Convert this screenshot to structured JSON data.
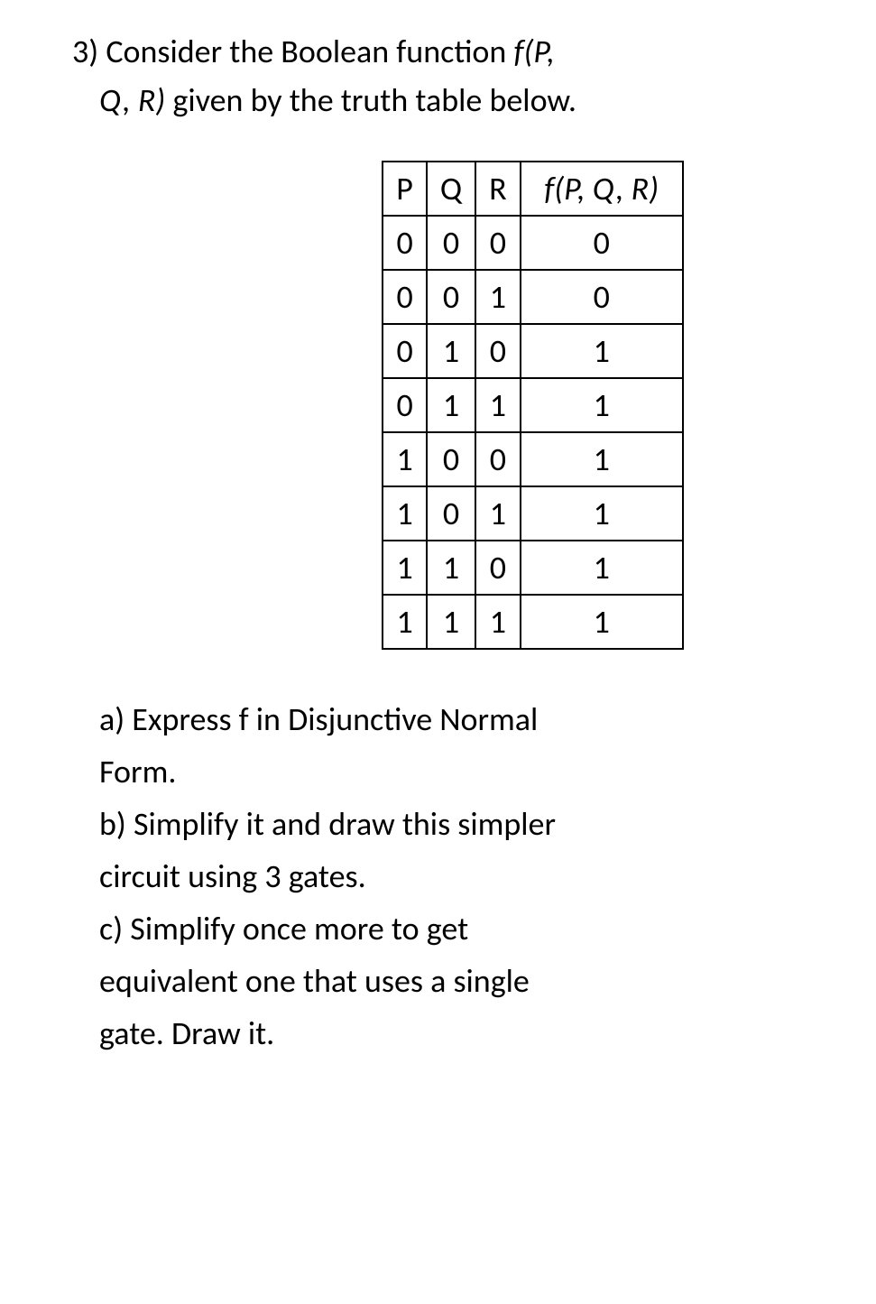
{
  "question": {
    "number": "3)",
    "intro_part1": "Consider the Boolean function ",
    "intro_fn1": "f(P,",
    "intro_fn2": "Q, R)",
    "intro_part2": " given by the truth table below."
  },
  "table": {
    "headers": {
      "p": "P",
      "q": "Q",
      "r": "R",
      "f": "f(P, Q, R)"
    },
    "rows": [
      {
        "p": "0",
        "q": "0",
        "r": "0",
        "f": "0"
      },
      {
        "p": "0",
        "q": "0",
        "r": "1",
        "f": "0"
      },
      {
        "p": "0",
        "q": "1",
        "r": "0",
        "f": "1"
      },
      {
        "p": "0",
        "q": "1",
        "r": "1",
        "f": "1"
      },
      {
        "p": "1",
        "q": "0",
        "r": "0",
        "f": "1"
      },
      {
        "p": "1",
        "q": "0",
        "r": "1",
        "f": "1"
      },
      {
        "p": "1",
        "q": "1",
        "r": "0",
        "f": "1"
      },
      {
        "p": "1",
        "q": "1",
        "r": "1",
        "f": "1"
      }
    ]
  },
  "parts": {
    "a1": "a) Express f in Disjunctive Normal",
    "a2": "Form.",
    "b1": "b) Simplify it and draw this simpler",
    "b2": "circuit using 3 gates.",
    "c1": "c) Simplify once more to get",
    "c2": "equivalent one that uses a single",
    "c3": "gate. Draw it."
  }
}
